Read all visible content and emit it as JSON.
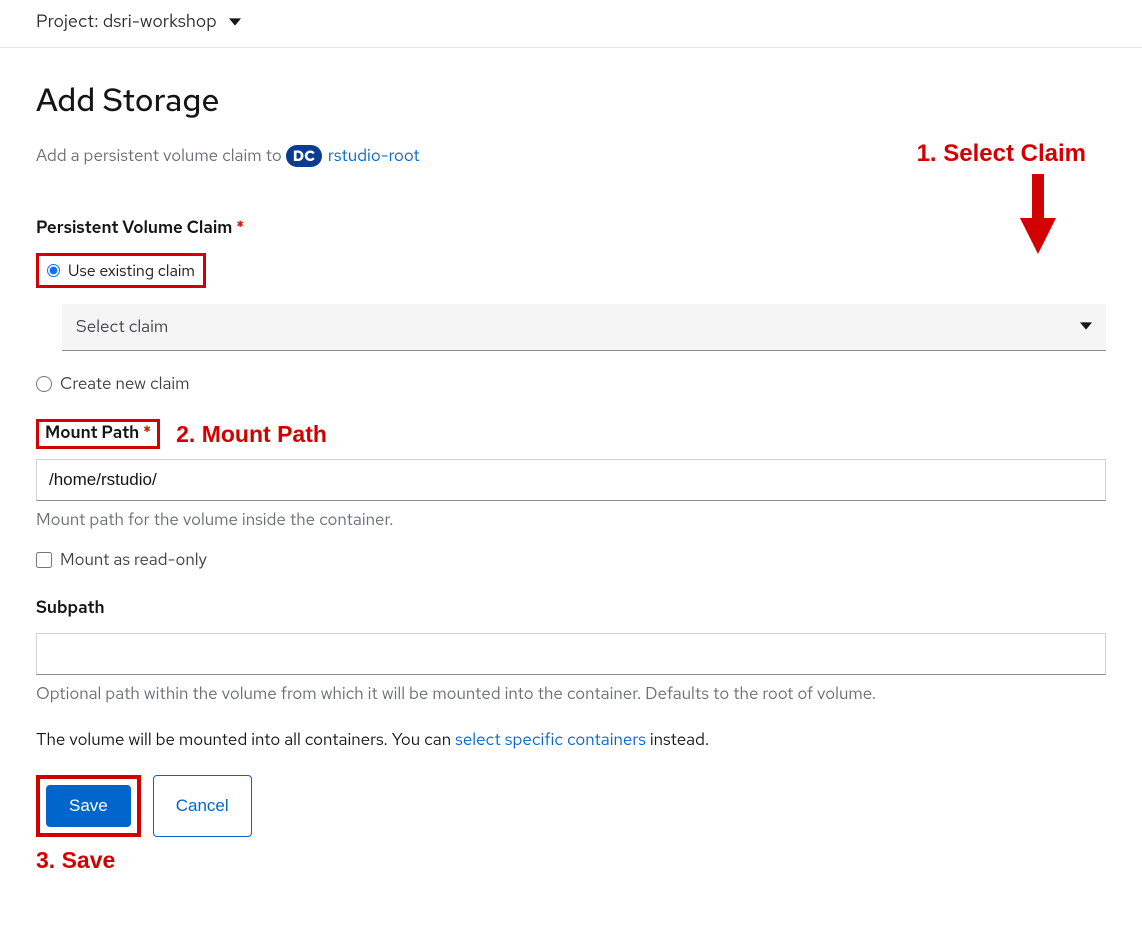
{
  "topbar": {
    "project_label": "Project: dsri-workshop"
  },
  "page": {
    "title": "Add Storage",
    "subtitle_prefix": "Add a persistent volume claim to",
    "dc_badge": "DC",
    "target_name": "rstudio-root"
  },
  "pvc": {
    "section_label": "Persistent Volume Claim",
    "option_existing": "Use existing claim",
    "option_new": "Create new claim",
    "select_placeholder": "Select claim"
  },
  "mount": {
    "label": "Mount Path",
    "value": "/home/rstudio/",
    "help": "Mount path for the volume inside the container.",
    "readonly_label": "Mount as read-only"
  },
  "subpath": {
    "label": "Subpath",
    "value": "",
    "help": "Optional path within the volume from which it will be mounted into the container. Defaults to the root of volume."
  },
  "containers_info": {
    "prefix": "The volume will be mounted into all containers. You can ",
    "link": "select specific containers",
    "suffix": " instead."
  },
  "buttons": {
    "save": "Save",
    "cancel": "Cancel"
  },
  "annotations": {
    "select_claim": "1. Select Claim",
    "mount_path": "2. Mount Path",
    "save": "3. Save"
  }
}
